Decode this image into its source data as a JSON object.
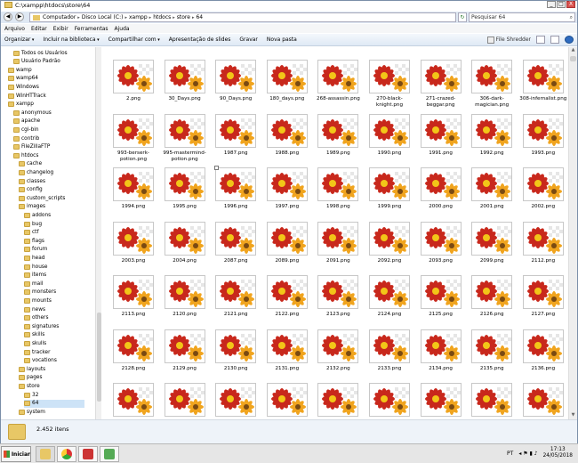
{
  "window": {
    "title": "C:\\xampp\\htdocs\\store\\64",
    "controls": [
      "_",
      "□",
      "X"
    ]
  },
  "address": {
    "crumbs": [
      "Computador",
      "Disco Local (C:)",
      "xampp",
      "htdocs",
      "store",
      "64"
    ],
    "separator": "▸",
    "search_placeholder": "Pesquisar 64"
  },
  "menu": [
    "Arquivo",
    "Editar",
    "Exibir",
    "Ferramentas",
    "Ajuda"
  ],
  "toolbar": {
    "items": [
      "Organizar",
      "Incluir na biblioteca",
      "Compartilhar com",
      "Apresentação de slides",
      "Gravar",
      "Nova pasta"
    ],
    "dropdown_items": [
      true,
      true,
      true,
      false,
      false,
      false
    ],
    "file_shredder": "File Shredder"
  },
  "nav": {
    "items": [
      {
        "label": "Todos os Usuários",
        "indent": 3
      },
      {
        "label": "Usuário Padrão",
        "indent": 3
      },
      {
        "label": "wamp",
        "indent": 2
      },
      {
        "label": "wamp64",
        "indent": 2
      },
      {
        "label": "Windows",
        "indent": 2
      },
      {
        "label": "WinHTTrack",
        "indent": 2
      },
      {
        "label": "xampp",
        "indent": 2
      },
      {
        "label": "anonymous",
        "indent": 3
      },
      {
        "label": "apache",
        "indent": 3
      },
      {
        "label": "cgi-bin",
        "indent": 3
      },
      {
        "label": "contrib",
        "indent": 3
      },
      {
        "label": "FileZillaFTP",
        "indent": 3
      },
      {
        "label": "htdocs",
        "indent": 3
      },
      {
        "label": "cache",
        "indent": 4
      },
      {
        "label": "changelog",
        "indent": 4
      },
      {
        "label": "classes",
        "indent": 4
      },
      {
        "label": "config",
        "indent": 4
      },
      {
        "label": "custom_scripts",
        "indent": 4
      },
      {
        "label": "images",
        "indent": 4
      },
      {
        "label": "addons",
        "indent": 5
      },
      {
        "label": "bug",
        "indent": 5
      },
      {
        "label": "ctf",
        "indent": 5
      },
      {
        "label": "flags",
        "indent": 5
      },
      {
        "label": "forum",
        "indent": 5
      },
      {
        "label": "head",
        "indent": 5
      },
      {
        "label": "house",
        "indent": 5
      },
      {
        "label": "items",
        "indent": 5
      },
      {
        "label": "mail",
        "indent": 5
      },
      {
        "label": "monsters",
        "indent": 5
      },
      {
        "label": "mounts",
        "indent": 5
      },
      {
        "label": "news",
        "indent": 5
      },
      {
        "label": "others",
        "indent": 5
      },
      {
        "label": "signatures",
        "indent": 5
      },
      {
        "label": "skills",
        "indent": 5
      },
      {
        "label": "skulls",
        "indent": 5
      },
      {
        "label": "tracker",
        "indent": 5
      },
      {
        "label": "vocations",
        "indent": 5
      },
      {
        "label": "layouts",
        "indent": 4
      },
      {
        "label": "pages",
        "indent": 4
      },
      {
        "label": "store",
        "indent": 4
      },
      {
        "label": "32",
        "indent": 5
      },
      {
        "label": "64",
        "indent": 5,
        "selected": true
      },
      {
        "label": "system",
        "indent": 4
      }
    ]
  },
  "files": [
    "2.png",
    "30_Days.png",
    "90_Days.png",
    "180_days.png",
    "268-assassin.png",
    "270-black-knight.png",
    "271-crazed-beggar.png",
    "306-dark-magician.png",
    "308-infernalist.png",
    "993-berserk-potion.png",
    "995-mastermind-potion.png",
    "1987.png",
    "1988.png",
    "1989.png",
    "1990.png",
    "1991.png",
    "1992.png",
    "1993.png",
    "1994.png",
    "1995.png",
    "1996.png",
    "1997.png",
    "1998.png",
    "1999.png",
    "2000.png",
    "2001.png",
    "2002.png",
    "2003.png",
    "2004.png",
    "2087.png",
    "2089.png",
    "2091.png",
    "2092.png",
    "2093.png",
    "2099.png",
    "2112.png",
    "2113.png",
    "2120.png",
    "2121.png",
    "2122.png",
    "2123.png",
    "2124.png",
    "2125.png",
    "2126.png",
    "2127.png",
    "2128.png",
    "2129.png",
    "2130.png",
    "2131.png",
    "2132.png",
    "2133.png",
    "2134.png",
    "2135.png",
    "2136.png",
    "",
    "",
    "",
    "",
    "",
    "",
    "",
    "",
    ""
  ],
  "status": {
    "item_count": "2.452 itens"
  },
  "taskbar": {
    "start_label": "Iniciar",
    "language": "PT",
    "time": "17:13",
    "date": "24/05/2018"
  },
  "colors": {
    "accent": "#2e6bbf",
    "selection": "#cde3f7",
    "folder": "#e8c766"
  }
}
